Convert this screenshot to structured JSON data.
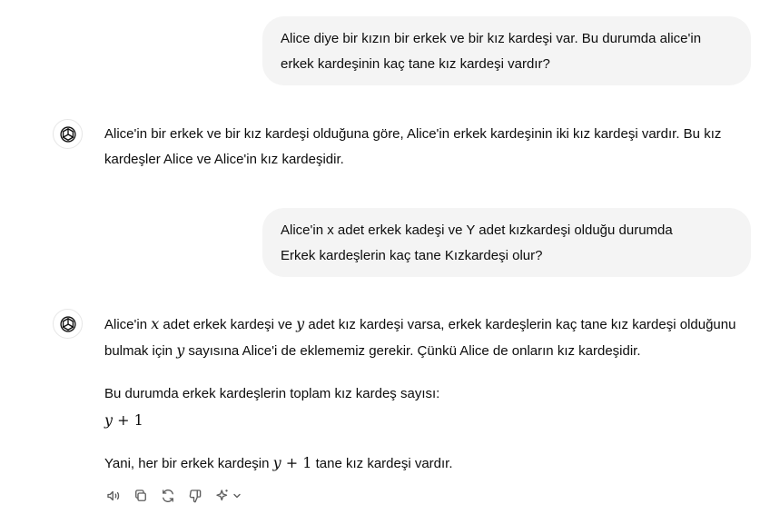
{
  "conversation": {
    "user_messages": [
      {
        "line1": "Alice diye bir kızın bir erkek ve bir kız kardeşi var. Bu durumda alice'in",
        "line2": "erkek kardeşinin kaç tane kız kardeşi vardır?"
      },
      {
        "line1": "Alice'in x adet erkek kadeşi ve Y adet kızkardeşi olduğu durumda",
        "line2": "Erkek kardeşlerin kaç tane Kızkardeşi olur?"
      }
    ],
    "assistant_messages": [
      {
        "text": "Alice'in bir erkek ve bir kız kardeşi olduğuna göre, Alice'in erkek kardeşinin iki kız kardeşi vardır. Bu kız kardeşler Alice ve Alice'in kız kardeşidir."
      },
      {
        "p1_part1": "Alice'in ",
        "p1_var_x": "x",
        "p1_part2": " adet erkek kardeşi ve ",
        "p1_var_y": "y",
        "p1_part3": " adet kız kardeşi varsa, erkek kardeşlerin kaç tane kız kardeşi olduğunu bulmak için ",
        "p1_var_y2": "y",
        "p1_part4": " sayısına Alice'i de eklememiz gerekir. Çünkü Alice de onların kız kardeşidir.",
        "p2_text": "Bu durumda erkek kardeşlerin toplam kız kardeş sayısı:",
        "formula_var": "y",
        "formula_rest": " + 1",
        "p3_part1": "Yani, her bir erkek kardeşin ",
        "p3_var": "y",
        "p3_rest_math": " + 1",
        "p3_part2": " tane kız kardeşi vardır."
      }
    ]
  },
  "action_bar": {
    "icons": [
      "read-aloud-icon",
      "copy-icon",
      "regenerate-icon",
      "thumbs-down-icon",
      "sparkle-icon",
      "chevron-down-icon"
    ]
  }
}
